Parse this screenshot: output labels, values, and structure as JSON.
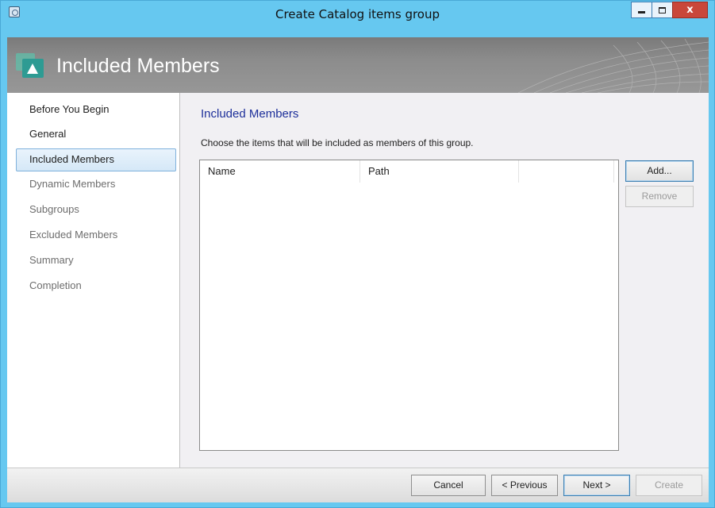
{
  "window": {
    "title": "Create Catalog items group",
    "app_icon": "wizard-app-icon",
    "minimize_glyph": "",
    "maximize_glyph": "",
    "close_glyph": "x"
  },
  "banner": {
    "title": "Included Members",
    "icon": "included-members-icon"
  },
  "nav": {
    "items": [
      {
        "label": "Before You Begin",
        "state": "normal"
      },
      {
        "label": "General",
        "state": "normal"
      },
      {
        "label": "Included Members",
        "state": "active"
      },
      {
        "label": "Dynamic Members",
        "state": "dim"
      },
      {
        "label": "Subgroups",
        "state": "dim"
      },
      {
        "label": "Excluded Members",
        "state": "dim"
      },
      {
        "label": "Summary",
        "state": "dim"
      },
      {
        "label": "Completion",
        "state": "dim"
      }
    ]
  },
  "main": {
    "title": "Included Members",
    "description": "Choose the items that will be included as members of this group.",
    "list": {
      "columns": [
        "Name",
        "Path",
        ""
      ],
      "rows": []
    },
    "add_label": "Add...",
    "remove_label": "Remove"
  },
  "footer": {
    "cancel_label": "Cancel",
    "previous_label": "< Previous",
    "next_label": "Next >",
    "create_label": "Create"
  },
  "colors": {
    "chrome": "#66c8f0",
    "accent_title": "#1d2f9a",
    "close_button": "#c9473a",
    "banner": "#8c8c8c"
  }
}
